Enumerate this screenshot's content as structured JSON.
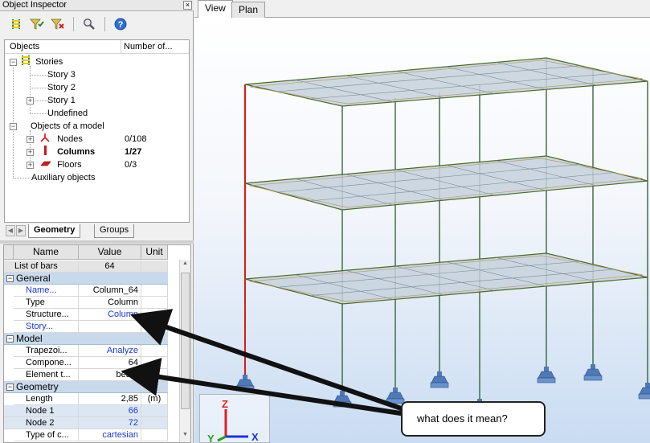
{
  "panel": {
    "title": "Object Inspector",
    "close_glyph": "×"
  },
  "toolbar": [
    {
      "name": "stories-filter-button",
      "icon": "stories-icon"
    },
    {
      "name": "filter-button",
      "icon": "filter-icon"
    },
    {
      "name": "filter-clear-button",
      "icon": "filter-clear-icon"
    },
    {
      "name": "find-button",
      "icon": "search-icon"
    },
    {
      "name": "help-button",
      "icon": "help-icon"
    }
  ],
  "tree": {
    "col_objects": "Objects",
    "col_number": "Number of...",
    "items": [
      {
        "label": "Stories",
        "level": 0
      },
      {
        "label": "Story 3",
        "level": 1
      },
      {
        "label": "Story 2",
        "level": 1
      },
      {
        "label": "Story 1",
        "level": 1
      },
      {
        "label": "Undefined",
        "level": 1
      },
      {
        "label": "Objects of a model",
        "level": 0
      },
      {
        "label": "Nodes",
        "count": "0/108",
        "level": 1
      },
      {
        "label": "Columns",
        "count": "1/27",
        "level": 1
      },
      {
        "label": "Floors",
        "count": "0/3",
        "level": 1
      },
      {
        "label": "Auxiliary objects",
        "level": 0
      }
    ]
  },
  "tabs": {
    "geometry": "Geometry",
    "groups": "Groups"
  },
  "grid": {
    "col_name": "Name",
    "col_value": "Value",
    "col_unit": "Unit",
    "list_label": "List of bars",
    "list_value": "64",
    "sections": {
      "general": "General",
      "model": "Model",
      "geometry": "Geometry"
    },
    "general_rows": [
      {
        "name": "Name...",
        "value": "Column_64",
        "blue_name": true,
        "blue_value": false
      },
      {
        "name": "Type",
        "value": "Column",
        "blue_name": false,
        "blue_value": false
      },
      {
        "name": "Structure...",
        "value": "Column",
        "blue_name": false,
        "blue_value": true
      },
      {
        "name": "Story...",
        "value": "",
        "blue_name": true,
        "blue_value": false
      }
    ],
    "model_rows": [
      {
        "name": "Trapezoi...",
        "value": "Analyze",
        "blue_value": true
      },
      {
        "name": "Compone...",
        "value": "64",
        "blue_value": false
      },
      {
        "name": "Element t...",
        "value": "beam",
        "blue_value": false
      }
    ],
    "geometry_rows": [
      {
        "name": "Length",
        "value": "2,85",
        "unit": "(m)",
        "expand": false,
        "highlight": false
      },
      {
        "name": "Node 1",
        "value": "66",
        "unit": "",
        "expand": true,
        "highlight": true
      },
      {
        "name": "Node 2",
        "value": "72",
        "unit": "",
        "expand": true,
        "highlight": true
      },
      {
        "name": "Type of c...",
        "value": "cartesian",
        "unit": "",
        "expand": false,
        "highlight": false
      }
    ]
  },
  "viewport_tabs": {
    "view": "View",
    "plan": "Plan"
  },
  "axes": {
    "x": "X",
    "y": "Y",
    "z": "Z"
  },
  "annotation": {
    "text": "what does it mean?"
  },
  "colors": {
    "column": "#2d5a2d",
    "selected_column": "#e01818",
    "slab_fill": "#c5d1dc",
    "slab_edge": "#4a6a2a",
    "support": "#4f79b8",
    "section_bg": "#c9d9ec",
    "link_blue": "#1a3ad0"
  }
}
